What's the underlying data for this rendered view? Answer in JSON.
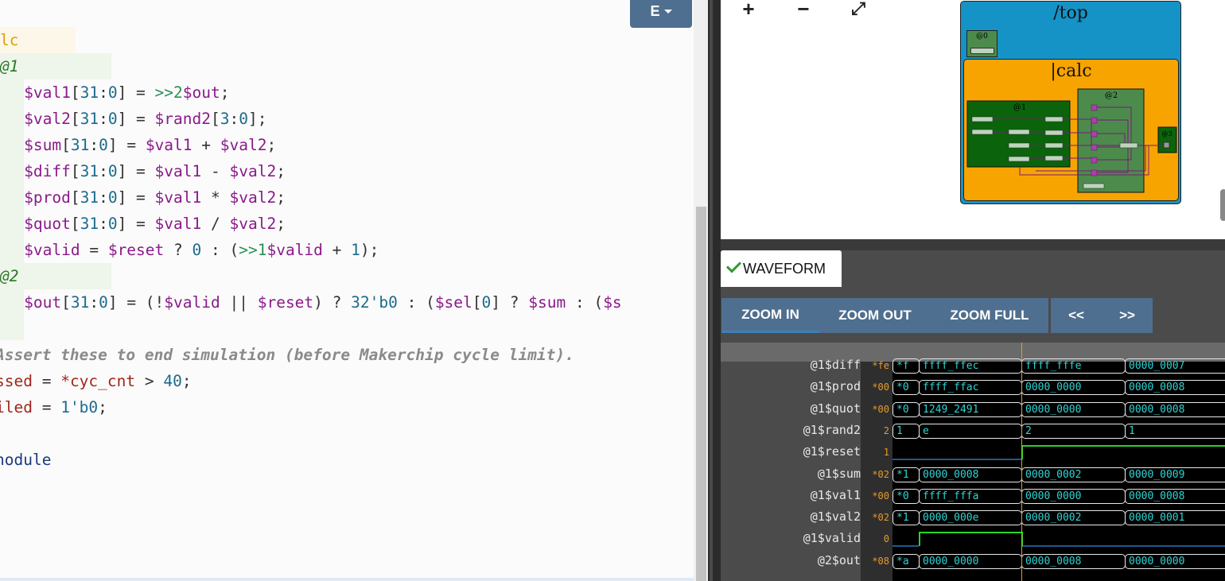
{
  "editor": {
    "toggle_button": "E",
    "lines": [
      {
        "spans": [
          {
            "t": "lc",
            "c": "c-stage"
          }
        ]
      },
      {
        "spans": [
          {
            "t": "@1",
            "c": "c-pipe"
          }
        ]
      },
      {
        "spans": [
          {
            "t": "   "
          },
          {
            "t": "$val1",
            "c": "c-var"
          },
          {
            "t": "[",
            "c": "c-op"
          },
          {
            "t": "31",
            "c": "c-num"
          },
          {
            "t": ":",
            "c": "c-op"
          },
          {
            "t": "0",
            "c": "c-num"
          },
          {
            "t": "] = ",
            "c": "c-op"
          },
          {
            "t": ">>2",
            "c": "c-ret"
          },
          {
            "t": "$out",
            "c": "c-var"
          },
          {
            "t": ";",
            "c": "c-op"
          }
        ]
      },
      {
        "spans": [
          {
            "t": "   "
          },
          {
            "t": "$val2",
            "c": "c-var"
          },
          {
            "t": "[",
            "c": "c-op"
          },
          {
            "t": "31",
            "c": "c-num"
          },
          {
            "t": ":",
            "c": "c-op"
          },
          {
            "t": "0",
            "c": "c-num"
          },
          {
            "t": "] = ",
            "c": "c-op"
          },
          {
            "t": "$rand2",
            "c": "c-var"
          },
          {
            "t": "[",
            "c": "c-op"
          },
          {
            "t": "3",
            "c": "c-num"
          },
          {
            "t": ":",
            "c": "c-op"
          },
          {
            "t": "0",
            "c": "c-num"
          },
          {
            "t": "];",
            "c": "c-op"
          }
        ]
      },
      {
        "spans": [
          {
            "t": "   "
          },
          {
            "t": "$sum",
            "c": "c-var"
          },
          {
            "t": "[",
            "c": "c-op"
          },
          {
            "t": "31",
            "c": "c-num"
          },
          {
            "t": ":",
            "c": "c-op"
          },
          {
            "t": "0",
            "c": "c-num"
          },
          {
            "t": "] = ",
            "c": "c-op"
          },
          {
            "t": "$val1",
            "c": "c-var"
          },
          {
            "t": " + ",
            "c": "c-op"
          },
          {
            "t": "$val2",
            "c": "c-var"
          },
          {
            "t": ";",
            "c": "c-op"
          }
        ]
      },
      {
        "spans": [
          {
            "t": "   "
          },
          {
            "t": "$diff",
            "c": "c-var"
          },
          {
            "t": "[",
            "c": "c-op"
          },
          {
            "t": "31",
            "c": "c-num"
          },
          {
            "t": ":",
            "c": "c-op"
          },
          {
            "t": "0",
            "c": "c-num"
          },
          {
            "t": "] = ",
            "c": "c-op"
          },
          {
            "t": "$val1",
            "c": "c-var"
          },
          {
            "t": " - ",
            "c": "c-op"
          },
          {
            "t": "$val2",
            "c": "c-var"
          },
          {
            "t": ";",
            "c": "c-op"
          }
        ]
      },
      {
        "spans": [
          {
            "t": "   "
          },
          {
            "t": "$prod",
            "c": "c-var"
          },
          {
            "t": "[",
            "c": "c-op"
          },
          {
            "t": "31",
            "c": "c-num"
          },
          {
            "t": ":",
            "c": "c-op"
          },
          {
            "t": "0",
            "c": "c-num"
          },
          {
            "t": "] = ",
            "c": "c-op"
          },
          {
            "t": "$val1",
            "c": "c-var"
          },
          {
            "t": " * ",
            "c": "c-op"
          },
          {
            "t": "$val2",
            "c": "c-var"
          },
          {
            "t": ";",
            "c": "c-op"
          }
        ]
      },
      {
        "spans": [
          {
            "t": "   "
          },
          {
            "t": "$quot",
            "c": "c-var"
          },
          {
            "t": "[",
            "c": "c-op"
          },
          {
            "t": "31",
            "c": "c-num"
          },
          {
            "t": ":",
            "c": "c-op"
          },
          {
            "t": "0",
            "c": "c-num"
          },
          {
            "t": "] = ",
            "c": "c-op"
          },
          {
            "t": "$val1",
            "c": "c-var"
          },
          {
            "t": " / ",
            "c": "c-op"
          },
          {
            "t": "$val2",
            "c": "c-var"
          },
          {
            "t": ";",
            "c": "c-op"
          }
        ]
      },
      {
        "spans": [
          {
            "t": "   "
          },
          {
            "t": "$valid",
            "c": "c-var"
          },
          {
            "t": " = ",
            "c": "c-op"
          },
          {
            "t": "$reset",
            "c": "c-var"
          },
          {
            "t": " ? ",
            "c": "c-op"
          },
          {
            "t": "0",
            "c": "c-num"
          },
          {
            "t": " : (",
            "c": "c-op"
          },
          {
            "t": ">>1",
            "c": "c-ret"
          },
          {
            "t": "$valid",
            "c": "c-var"
          },
          {
            "t": " + ",
            "c": "c-op"
          },
          {
            "t": "1",
            "c": "c-num"
          },
          {
            "t": ");",
            "c": "c-op"
          }
        ]
      },
      {
        "spans": [
          {
            "t": "@2",
            "c": "c-pipe"
          }
        ]
      },
      {
        "spans": [
          {
            "t": "   "
          },
          {
            "t": "$out",
            "c": "c-var"
          },
          {
            "t": "[",
            "c": "c-op"
          },
          {
            "t": "31",
            "c": "c-num"
          },
          {
            "t": ":",
            "c": "c-op"
          },
          {
            "t": "0",
            "c": "c-num"
          },
          {
            "t": "] = (!",
            "c": "c-op"
          },
          {
            "t": "$valid",
            "c": "c-var"
          },
          {
            "t": " || ",
            "c": "c-op"
          },
          {
            "t": "$reset",
            "c": "c-var"
          },
          {
            "t": ") ? ",
            "c": "c-op"
          },
          {
            "t": "32'b0",
            "c": "c-num"
          },
          {
            "t": " : (",
            "c": "c-op"
          },
          {
            "t": "$sel",
            "c": "c-var"
          },
          {
            "t": "[",
            "c": "c-op"
          },
          {
            "t": "0",
            "c": "c-num"
          },
          {
            "t": "] ? ",
            "c": "c-op"
          },
          {
            "t": "$sum",
            "c": "c-var"
          },
          {
            "t": " : (",
            "c": "c-op"
          },
          {
            "t": "$s",
            "c": "c-var"
          }
        ]
      },
      {
        "spans": []
      },
      {
        "spans": [
          {
            "t": "Assert these to end simulation (before Makerchip cycle limit).",
            "c": "c-cmt"
          }
        ]
      },
      {
        "spans": [
          {
            "t": "ssed",
            "c": "c-red"
          },
          {
            "t": " = ",
            "c": "c-op"
          },
          {
            "t": "*cyc_cnt",
            "c": "c-red"
          },
          {
            "t": " > ",
            "c": "c-op"
          },
          {
            "t": "40",
            "c": "c-num"
          },
          {
            "t": ";",
            "c": "c-op"
          }
        ]
      },
      {
        "spans": [
          {
            "t": "iled",
            "c": "c-red"
          },
          {
            "t": " = ",
            "c": "c-op"
          },
          {
            "t": "1'b0",
            "c": "c-num"
          },
          {
            "t": ";",
            "c": "c-op"
          }
        ]
      },
      {
        "spans": []
      },
      {
        "spans": [
          {
            "t": "nodule",
            "c": "c-kw"
          }
        ]
      }
    ]
  },
  "diagram": {
    "tools": [
      {
        "name": "zoom-in-icon",
        "glyph": "+"
      },
      {
        "name": "zoom-out-icon",
        "glyph": "−"
      },
      {
        "name": "fit-icon",
        "glyph": "⤢"
      }
    ],
    "top_label": "/top",
    "calc_label": "|calc",
    "stage0_label": "@0",
    "stage1_label": "@1",
    "stage2_label": "@2",
    "stage3_label": "@3",
    "colors": {
      "top": "#1693c6",
      "calc": "#f8a400",
      "stage_dark": "#0b640b",
      "stage_mid": "#4c8b4c",
      "wire": "#7a1a7a"
    }
  },
  "waveform": {
    "tab_label": "WAVEFORM",
    "buttons": {
      "zoom_in": "ZOOM IN",
      "zoom_out": "ZOOM OUT",
      "zoom_full": "ZOOM FULL",
      "prev": "<<",
      "next": ">>"
    },
    "signals": [
      {
        "name": "@1$diff",
        "cur": "*fe",
        "type": "bus",
        "values": [
          "*f",
          "ffff_ffec",
          "ffff_fffe",
          "0000_0007"
        ]
      },
      {
        "name": "@1$prod",
        "cur": "*00",
        "type": "bus",
        "values": [
          "*0",
          "ffff_ffac",
          "0000_0000",
          "0000_0008"
        ]
      },
      {
        "name": "@1$quot",
        "cur": "*00",
        "type": "bus",
        "values": [
          "*0",
          "1249_2491",
          "0000_0000",
          "0000_0008"
        ]
      },
      {
        "name": "@1$rand2",
        "cur": "2",
        "type": "bus",
        "values": [
          "1",
          "e",
          "2",
          "1"
        ]
      },
      {
        "name": "@1$reset",
        "cur": "1",
        "type": "bit",
        "values": [
          "0",
          "0",
          "1",
          "1"
        ]
      },
      {
        "name": "@1$sum",
        "cur": "*02",
        "type": "bus",
        "values": [
          "*1",
          "0000_0008",
          "0000_0002",
          "0000_0009"
        ]
      },
      {
        "name": "@1$val1",
        "cur": "*00",
        "type": "bus",
        "values": [
          "*0",
          "ffff_fffa",
          "0000_0000",
          "0000_0008"
        ]
      },
      {
        "name": "@1$val2",
        "cur": "*02",
        "type": "bus",
        "values": [
          "*1",
          "0000_000e",
          "0000_0002",
          "0000_0001"
        ]
      },
      {
        "name": "@1$valid",
        "cur": "0",
        "type": "bit",
        "values": [
          "0",
          "1",
          "0",
          "0"
        ]
      },
      {
        "name": "@2$out",
        "cur": "*08",
        "type": "bus",
        "values": [
          "*a",
          "0000_0000",
          "0000_0008",
          "0000_0000"
        ]
      }
    ]
  }
}
